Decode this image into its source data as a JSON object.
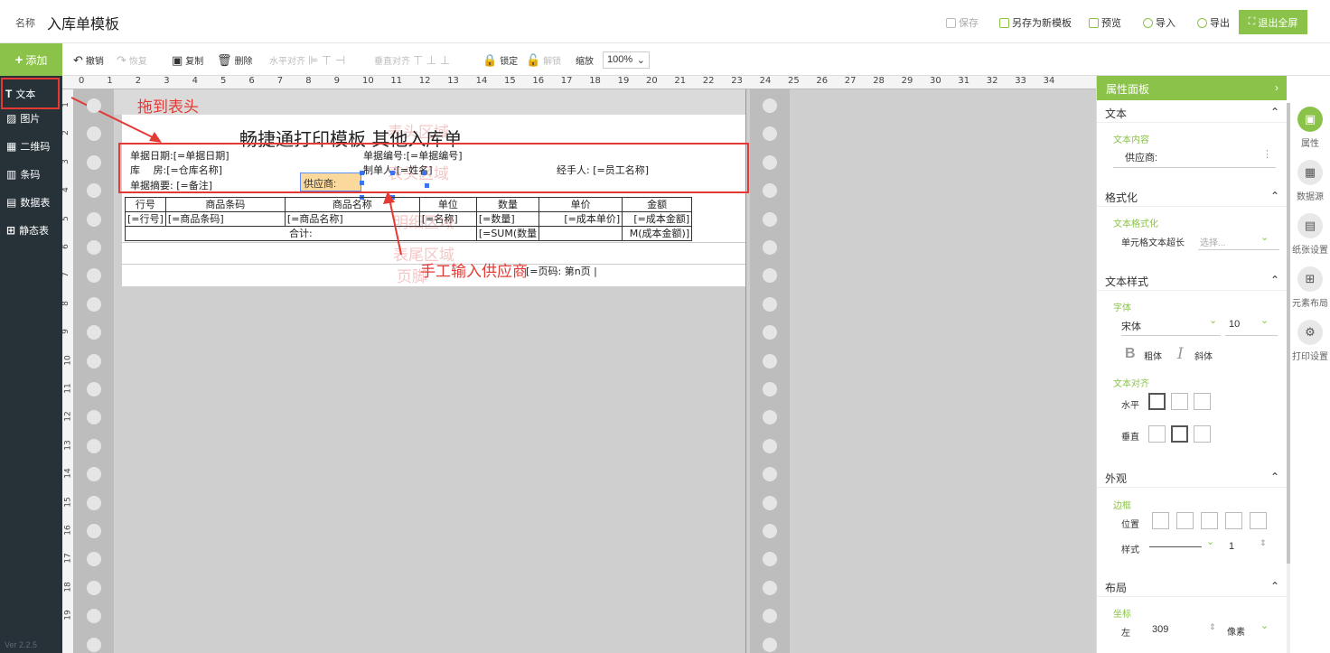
{
  "header": {
    "name_label": "名称",
    "title": "入库单模板",
    "save": "保存",
    "save_as": "另存为新模板",
    "preview": "预览",
    "import": "导入",
    "export": "导出",
    "exit_fullscreen": "退出全屏"
  },
  "toolbar": {
    "add": "添加",
    "undo": "撤销",
    "redo": "恢复",
    "copy": "复制",
    "delete": "删除",
    "h_align": "水平对齐",
    "v_align": "垂直对齐",
    "lock": "锁定",
    "unlock": "解锁",
    "zoom_label": "缩放",
    "zoom_value": "100%"
  },
  "sidebar": {
    "items": [
      {
        "label": "文本",
        "icon": "text-icon"
      },
      {
        "label": "图片",
        "icon": "image-icon"
      },
      {
        "label": "二维码",
        "icon": "qrcode-icon"
      },
      {
        "label": "条码",
        "icon": "barcode-icon"
      },
      {
        "label": "数据表",
        "icon": "data-table-icon"
      },
      {
        "label": "静态表",
        "icon": "static-table-icon"
      }
    ],
    "version": "Ver 2.2.5"
  },
  "ruler": {
    "top": [
      "0",
      "1",
      "2",
      "3",
      "4",
      "5",
      "6",
      "7",
      "8",
      "9",
      "10",
      "11",
      "12",
      "13",
      "14",
      "15",
      "16",
      "17",
      "18",
      "19",
      "20",
      "21",
      "22",
      "23",
      "24",
      "25",
      "26",
      "27",
      "28",
      "29",
      "30",
      "31",
      "32",
      "33",
      "34"
    ],
    "left": [
      "1",
      "2",
      "3",
      "4",
      "5",
      "6",
      "7",
      "8",
      "9",
      "10",
      "11",
      "12",
      "13",
      "14",
      "15",
      "16",
      "17",
      "18",
      "19"
    ]
  },
  "paper": {
    "title": "畅捷通打印模板 其他入库单",
    "watermarks": {
      "header": "表头区域",
      "detail": "明细区域",
      "footer": "表尾区域",
      "page": "页脚"
    },
    "fields": {
      "date": "单据日期:[=单据日期]",
      "number": "单据编号:[=单据编号]",
      "warehouse": "库　 房:[=仓库名称]",
      "maker": "制单人:[=姓名]",
      "handler": "经手人: [=员工名称]",
      "summary": "单据摘要: [=备注]",
      "supplier": "供应商:"
    },
    "table": {
      "headers": [
        "行号",
        "商品条码",
        "商品名称",
        "单位",
        "数量",
        "单价",
        "金额"
      ],
      "row": [
        "[=行号]",
        "[=商品条码]",
        "[=商品名称]",
        "[=名称]",
        "[=数量]",
        "[=成本单价]",
        "[=成本金额]"
      ],
      "total_label": "合计:",
      "total_qty": "[=SUM(数量",
      "total_amt": "M(成本金额)]"
    },
    "page_number": "[=页码: 第n页 |"
  },
  "annotations": {
    "drag_to_header": "拖到表头",
    "manual_supplier": "手工输入供应商"
  },
  "props": {
    "title": "属性面板",
    "text_section": "文本",
    "text_content_label": "文本内容",
    "text_content_value": "供应商:",
    "format_section": "格式化",
    "text_format_label": "文本格式化",
    "cell_overflow_label": "单元格文本超长",
    "cell_overflow_placeholder": "选择...",
    "style_section": "文本样式",
    "font_label": "字体",
    "font_value": "宋体",
    "size_value": "10",
    "bold": "粗体",
    "italic": "斜体",
    "align_label": "文本对齐",
    "horizontal": "水平",
    "vertical": "垂直",
    "appearance_section": "外观",
    "border_label": "边框",
    "position_label": "位置",
    "style_label": "样式",
    "border_width": "1",
    "layout_section": "布局",
    "coord_label": "坐标",
    "left_label": "左",
    "left_value": "309",
    "unit_value": "像素"
  },
  "right_nav": [
    {
      "label": "属性",
      "icon": "properties-icon"
    },
    {
      "label": "数据源",
      "icon": "datasource-icon"
    },
    {
      "label": "纸张设置",
      "icon": "paper-icon"
    },
    {
      "label": "元素布局",
      "icon": "layout-icon"
    },
    {
      "label": "打印设置",
      "icon": "settings-icon"
    }
  ],
  "colors": {
    "accent": "#8bc34a",
    "sidebar": "#263238",
    "annotation": "#e53935"
  }
}
